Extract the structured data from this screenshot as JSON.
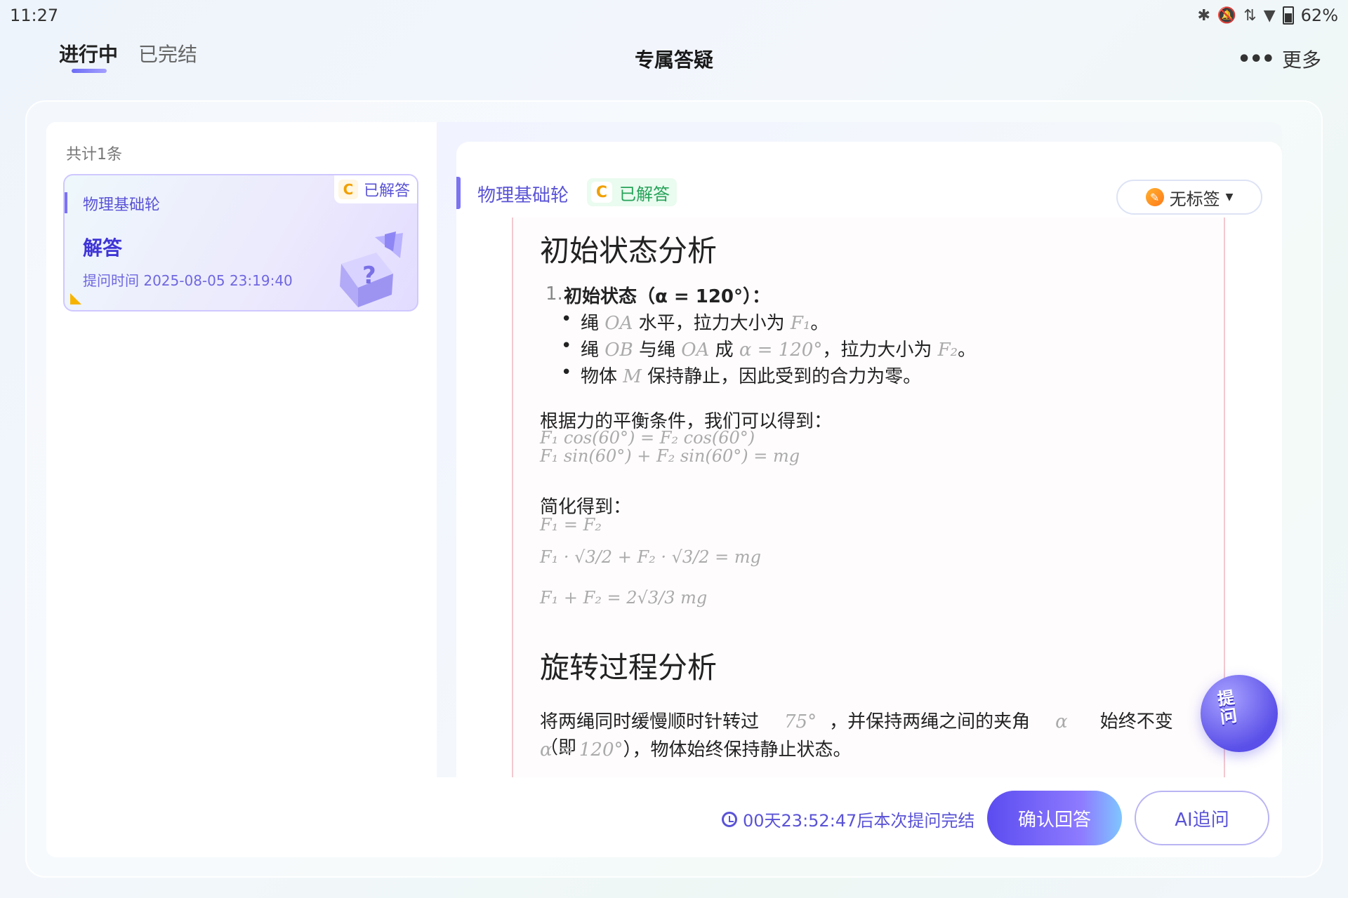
{
  "status_bar": {
    "time": "11:27",
    "battery": "62%",
    "icons": [
      "bluetooth-icon",
      "bell-off-icon",
      "data-arrows-icon",
      "wifi-icon",
      "battery-icon"
    ]
  },
  "header": {
    "tabs": [
      {
        "label": "进行中",
        "active": true
      },
      {
        "label": "已完结",
        "active": false
      }
    ],
    "title": "专属答疑",
    "more_label": "更多"
  },
  "left_panel": {
    "total": "共计1条",
    "questions": [
      {
        "subject": "物理基础轮",
        "badge_letter": "C",
        "status": "已解答",
        "title": "解答",
        "time": "提问时间 2025-08-05 23:19:40"
      }
    ]
  },
  "detail": {
    "subject": "物理基础轮",
    "badge_letter": "C",
    "status": "已解答",
    "tag_label": "无标签",
    "answer": {
      "h1": "初始状态分析",
      "li_num": "1.",
      "li_head": "初始状态（α = 120°）：",
      "bullets": [
        {
          "pre": "绳 ",
          "m1": "OA",
          "mid": " 水平，拉力大小为 ",
          "m2": "F₁",
          "post": "。"
        },
        {
          "pre": "绳 ",
          "m1": "OB",
          "mid": " 与绳 ",
          "m2": "OA",
          "mid2": " 成 ",
          "m3": "α = 120°",
          "mid3": "，拉力大小为 ",
          "m4": "F₂",
          "post": "。"
        },
        {
          "pre": "物体 ",
          "m1": "M",
          "mid": " 保持静止，因此受到的合力为零。"
        }
      ],
      "para1": "根据力的平衡条件，我们可以得到：",
      "eq1": "F₁ cos(60°) = F₂ cos(60°)",
      "eq2": "F₁ sin(60°) + F₂ sin(60°) = mg",
      "para2": "简化得到：",
      "eq3": "F₁ = F₂",
      "eq4": "F₁ · √3/2 + F₂ · √3/2 = mg",
      "eq5": "F₁ + F₂ = 2√3/3 mg",
      "h2": "旋转过程分析",
      "para3_a": "将两绳同时缓慢顺时针转过",
      "para3_m1": "75°",
      "para3_b": "，并保持两绳之间的夹角",
      "para3_m2": "α",
      "para3_c": "始终不变（即",
      "para3_m3": "α = 120°",
      "para3_d": "），物体始终保持静止状态。"
    },
    "fab_label": "提问"
  },
  "footer": {
    "timer": "00天23:52:47后本次提问完结",
    "confirm_label": "确认回答",
    "ai_label": "AI追问"
  },
  "colors": {
    "accent": "#5a53d6",
    "badge_orange": "#f0a000",
    "answered_green": "#27a35a"
  }
}
